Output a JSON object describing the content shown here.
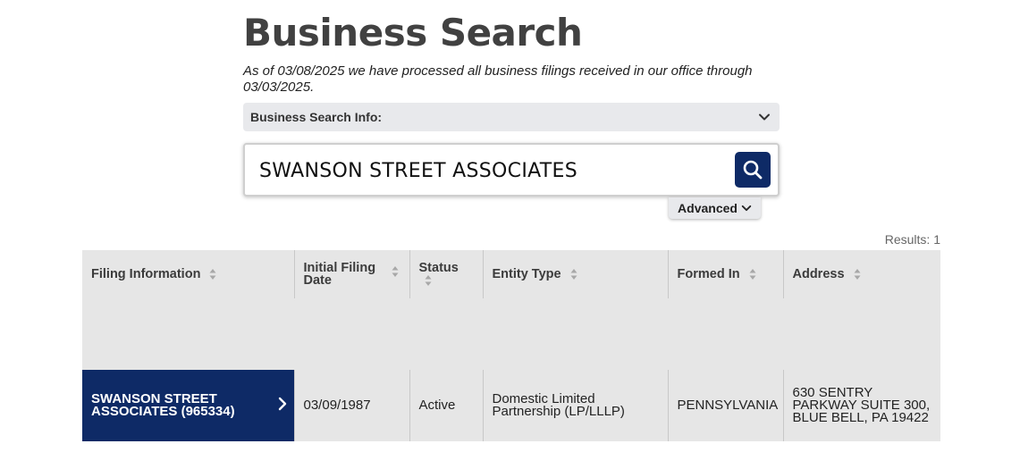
{
  "header": {
    "title": "Business Search",
    "subtitle": "As of 03/08/2025 we have processed all business filings received in our office through 03/03/2025."
  },
  "info_bar": {
    "label": "Business Search Info:",
    "icon": "chevron-down-icon"
  },
  "search": {
    "value": "SWANSON STREET ASSOCIATES",
    "button_icon": "search-icon"
  },
  "advanced": {
    "label": "Advanced",
    "icon": "chevron-down-icon"
  },
  "results": {
    "count_label": "Results: 1"
  },
  "table": {
    "columns": [
      "Filing Information",
      "Initial Filing Date",
      "Status",
      "Entity Type",
      "Formed In",
      "Address"
    ],
    "rows": [
      {
        "filing_info": "SWANSON STREET ASSOCIATES (965334)",
        "initial_filing_date": "03/09/1987",
        "status": "Active",
        "entity_type": "Domestic Limited Partnership (LP/LLLP)",
        "formed_in": "PENNSYLVANIA",
        "address": "630 SENTRY PARKWAY SUITE 300, BLUE BELL, PA  19422"
      }
    ]
  },
  "colors": {
    "primary": "#0e2a66",
    "header_bg": "#e6e6e6",
    "info_bg": "#e8e9ec"
  }
}
